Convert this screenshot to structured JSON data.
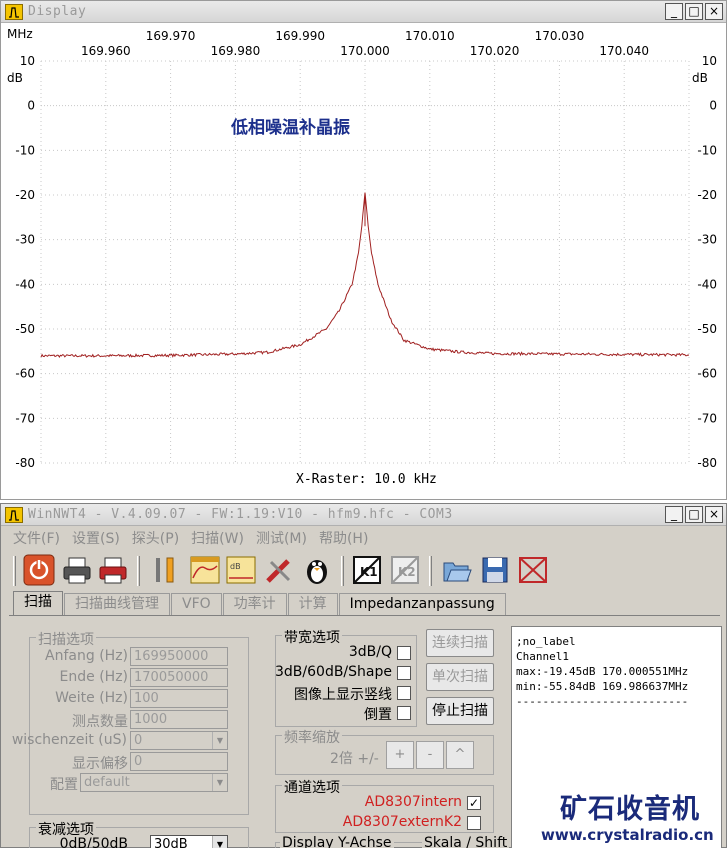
{
  "display": {
    "title": "Display",
    "unit_freq": "MHz",
    "unit_db": "dB",
    "x_raster": "X-Raster: 10.0 kHz",
    "annotation": "低相噪温补晶振",
    "trace_color": "#a02020"
  },
  "chart_data": {
    "type": "line",
    "x_unit": "MHz",
    "y_unit": "dB",
    "xlim": [
      169.95,
      170.05
    ],
    "ylim": [
      -80,
      10
    ],
    "x_ticks_upper": [
      "169.970",
      "169.990",
      "170.010",
      "170.030"
    ],
    "x_ticks_upper_values": [
      169.97,
      169.99,
      170.01,
      170.03
    ],
    "x_ticks_lower": [
      "169.960",
      "169.980",
      "170.000",
      "170.020",
      "170.040"
    ],
    "x_ticks_lower_values": [
      169.96,
      169.98,
      170.0,
      170.02,
      170.04
    ],
    "y_ticks": [
      "10",
      "0",
      "-10",
      "-20",
      "-30",
      "-40",
      "-50",
      "-60",
      "-70",
      "-80"
    ],
    "y_tick_values": [
      10,
      0,
      -10,
      -20,
      -30,
      -40,
      -50,
      -60,
      -70,
      -80
    ],
    "grid": true,
    "series": [
      {
        "x": [
          169.95,
          169.96,
          169.97,
          169.98,
          169.985,
          169.99,
          169.994,
          169.996,
          169.998,
          169.999,
          169.9995,
          170.0,
          170.0005,
          170.001,
          170.002,
          170.004,
          170.006,
          170.01,
          170.015,
          170.02,
          170.03,
          170.04,
          170.05
        ],
        "y": [
          -56.0,
          -56.0,
          -55.9,
          -55.6,
          -55.2,
          -53.5,
          -50.0,
          -46.0,
          -40.0,
          -33.0,
          -27.0,
          -19.45,
          -27.0,
          -33.0,
          -40.0,
          -48.0,
          -52.5,
          -54.5,
          -55.2,
          -55.5,
          -55.6,
          -55.7,
          -55.8
        ]
      }
    ],
    "max_marker": {
      "x": 170.000551,
      "y": -19.45
    },
    "min_marker": {
      "x": 169.986637,
      "y": -55.84
    }
  },
  "main": {
    "title": "WinNWT4 - V.4.09.07 - FW:1.19:V10 - hfm9.hfc - COM3",
    "menu": [
      "文件(F)",
      "设置(S)",
      "探头(P)",
      "扫描(W)",
      "测试(M)",
      "帮助(H)"
    ],
    "tabs": [
      "扫描",
      "扫描曲线管理",
      "VFO",
      "功率计",
      "计算",
      "Impedanzanpassung"
    ],
    "sweep_options": {
      "title": "扫描选项",
      "fields": [
        {
          "label": "Anfang (Hz)",
          "value": "169950000"
        },
        {
          "label": "Ende (Hz)",
          "value": "170050000"
        },
        {
          "label": "Weite (Hz)",
          "value": "100"
        },
        {
          "label": "测点数量",
          "value": "1000"
        },
        {
          "label": "wischenzeit (uS)",
          "value": "0"
        },
        {
          "label": "显示偏移",
          "value": "0"
        },
        {
          "label": "配置",
          "value": "default"
        }
      ]
    },
    "attenuation": {
      "title": "衰减选项",
      "label": "0dB/50dB",
      "value": "30dB"
    },
    "bandwidth": {
      "title": "带宽选项",
      "items": [
        {
          "label": "3dB/Q",
          "checked": false
        },
        {
          "label": "3dB/60dB/Shape",
          "checked": false
        },
        {
          "label": "图像上显示竖线",
          "checked": false
        },
        {
          "label": "倒置",
          "checked": false
        }
      ]
    },
    "buttons": {
      "continuous": "连续扫描",
      "single": "单次扫描",
      "stop": "停止扫描"
    },
    "zoom": {
      "title": "频率缩放",
      "label": "2倍 +/-",
      "plus": "+",
      "minus": "-",
      "caret": "^"
    },
    "channel": {
      "title": "通道选项",
      "items": [
        {
          "label": "AD8307intern",
          "checked": true,
          "mark": "✓"
        },
        {
          "label": "AD8307externK2",
          "checked": false,
          "mark": ""
        }
      ]
    },
    "display_yaxis": "Display Y-Achse",
    "skala": "Skala / Shift",
    "result_lines": [
      ";no_label",
      "",
      "Channel1",
      "max:-19.45dB 170.000551MHz",
      "min:-55.84dB 169.986637MHz",
      "--------------------------"
    ]
  },
  "watermark": {
    "logo": "矿石收音机",
    "url": "www.crystalradio.cn",
    "color": "#1a2a7a"
  }
}
